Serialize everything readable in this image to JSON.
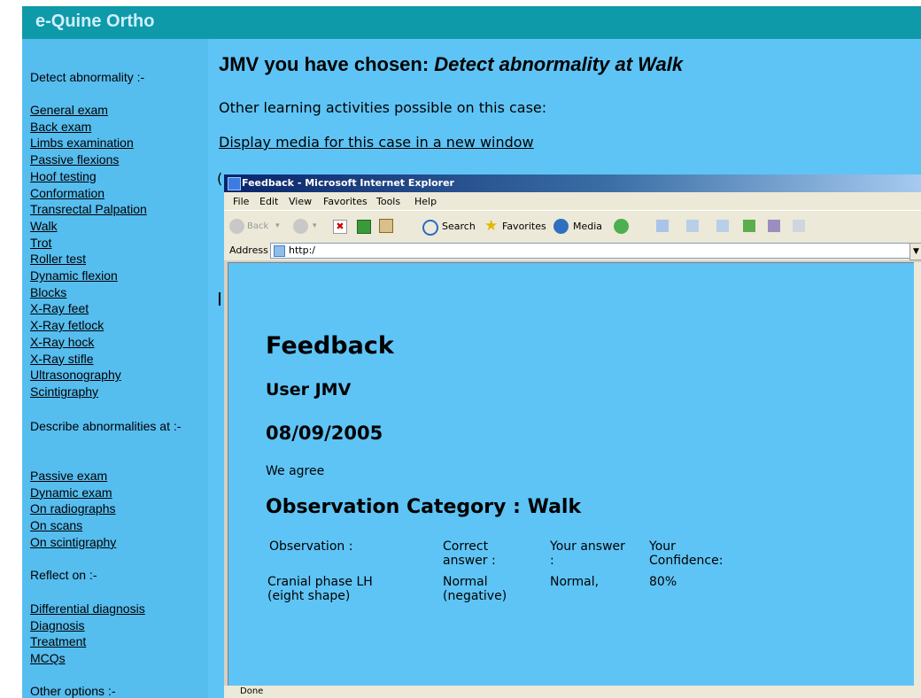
{
  "app": {
    "brand": "e-Quine Ortho"
  },
  "sidebar": {
    "sections": [
      {
        "heading": "Detect abnormality :-",
        "links": [
          "General exam",
          "Back exam",
          "Limbs examination",
          "Passive flexions",
          "Hoof testing",
          "Conformation",
          "Transrectal Palpation",
          "Walk",
          "Trot",
          "Roller test",
          "Dynamic flexion",
          "Blocks",
          "X-Ray feet",
          "X-Ray fetlock",
          "X-Ray hock",
          "X-Ray stifle",
          "Ultrasonography",
          "Scintigraphy"
        ]
      },
      {
        "heading": "Describe abnormalities at :-",
        "links": [
          "Passive exam",
          "Dynamic exam",
          "On radiographs",
          "On scans",
          "On scintigraphy"
        ]
      },
      {
        "heading": "Reflect on :-",
        "links": [
          "Differential diagnosis",
          "Diagnosis",
          "Treatment",
          "MCQs"
        ]
      },
      {
        "heading": "Other options :-",
        "links": []
      }
    ]
  },
  "main": {
    "title_prefix": "JMV you have chosen: ",
    "title_activity": "Detect abnormality at Walk",
    "other_activities": "Other learning activities possible on this case:",
    "media_link": "Display media for this case in a new window"
  },
  "popup": {
    "window_title": "Feedback - Microsoft Internet Explorer",
    "menu": [
      "File",
      "Edit",
      "View",
      "Favorites",
      "Tools",
      "Help"
    ],
    "toolbar": {
      "back": "Back",
      "search": "Search",
      "favorites": "Favorites",
      "media": "Media"
    },
    "address_label": "Address",
    "address_value": "http:/",
    "status": "Done",
    "feedback": {
      "heading": "Feedback",
      "user": "User JMV",
      "date": "08/09/2005",
      "message": "We agree",
      "category": "Observation Category : Walk",
      "table": {
        "headers": [
          "Observation :",
          "Correct answer :",
          "Your answer :",
          "Your Confidence:"
        ],
        "rows": [
          [
            "Cranial phase LH (eight shape)",
            "Normal (negative)",
            "Normal,",
            "80%"
          ]
        ]
      }
    }
  },
  "colors": {
    "page_bg": "#5ec4f5",
    "sidebar_bg": "#56bdef",
    "brand_bar": "#0e9aa8"
  }
}
